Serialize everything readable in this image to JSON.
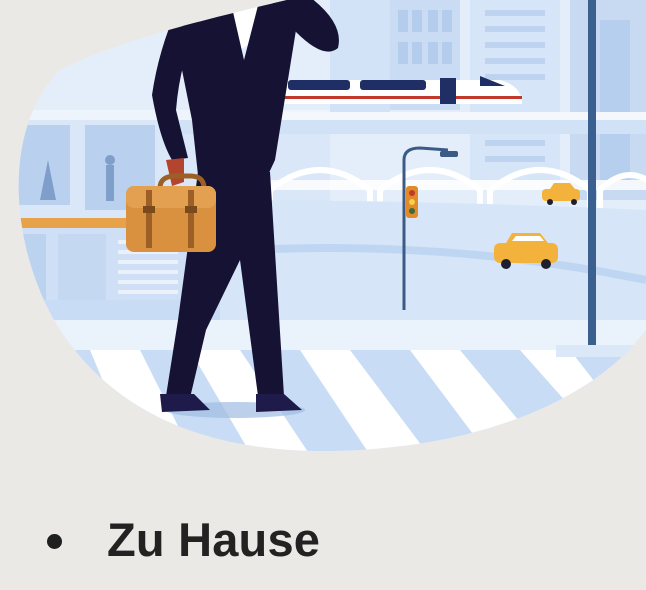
{
  "illustration": {
    "icon": "businessman-city-illustration",
    "colors": {
      "sky": "#ddeafa",
      "building": "#bcd4f0",
      "road": "#c9dcf5",
      "suit": "#161233",
      "briefcase": "#d9913f",
      "taxi": "#f3b23c",
      "train_stripe": "#c0392b"
    }
  },
  "list": {
    "items": [
      {
        "label": "Zu Hause"
      }
    ]
  }
}
